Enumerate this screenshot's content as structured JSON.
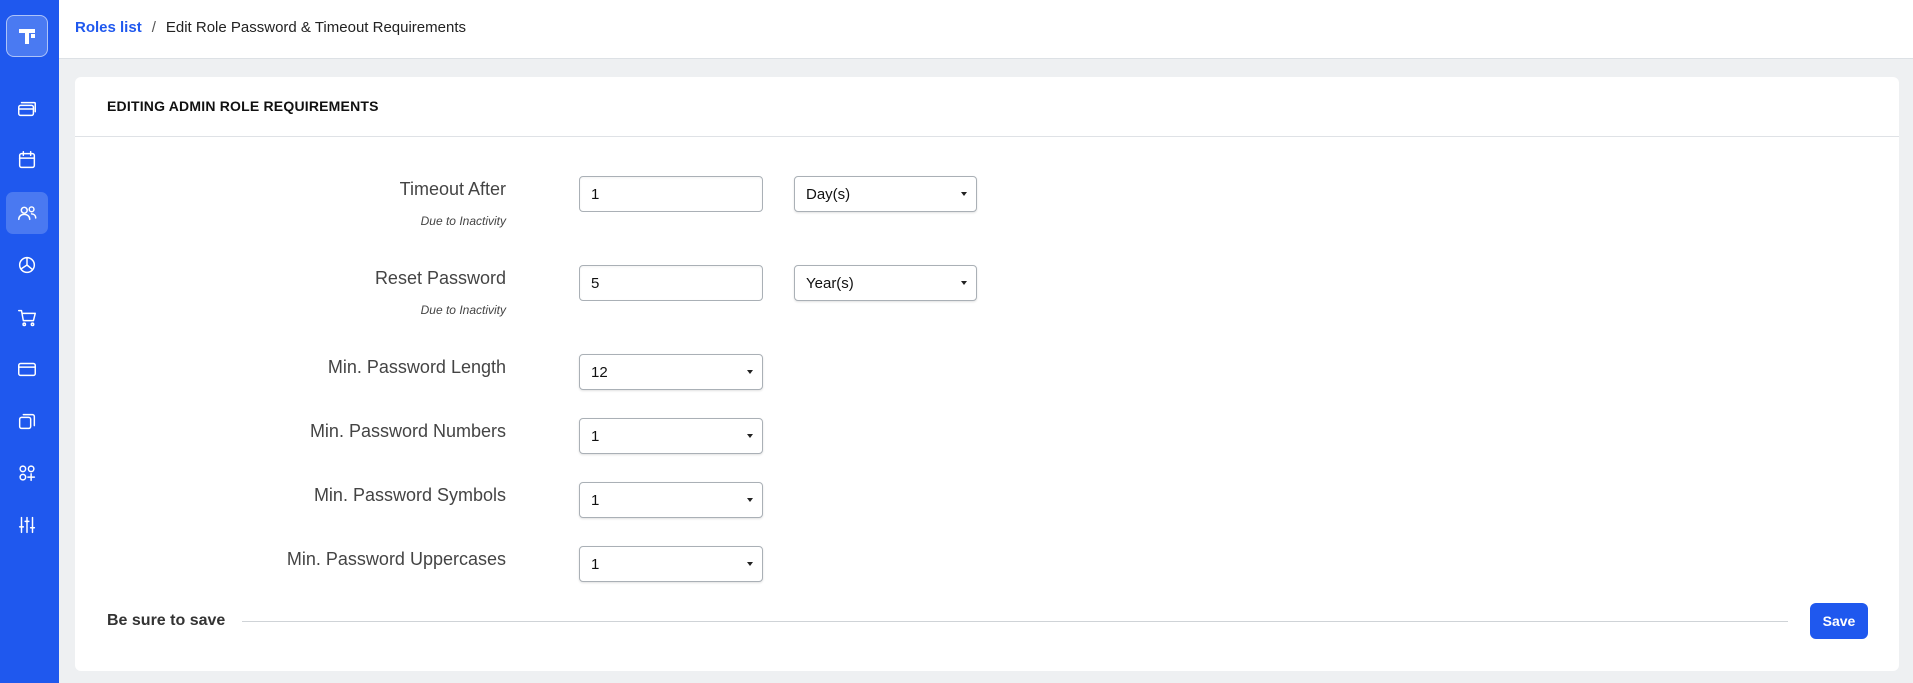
{
  "breadcrumb": {
    "link": "Roles list",
    "separator": "/",
    "current": "Edit Role Password & Timeout Requirements"
  },
  "sidebar": {
    "logo_icon": "app-logo-icon",
    "items": [
      {
        "icon": "cards-icon",
        "active": false
      },
      {
        "icon": "calendar-icon",
        "active": false
      },
      {
        "icon": "users-icon",
        "active": true
      },
      {
        "icon": "pie-chart-icon",
        "active": false
      },
      {
        "icon": "cart-icon",
        "active": false
      },
      {
        "icon": "credit-card-icon",
        "active": false
      },
      {
        "icon": "copy-icon",
        "active": false
      },
      {
        "icon": "apps-add-icon",
        "active": false
      },
      {
        "icon": "sliders-icon",
        "active": false
      }
    ]
  },
  "card": {
    "title": "EDITING ADMIN ROLE REQUIREMENTS"
  },
  "form": {
    "timeout": {
      "label": "Timeout After",
      "sub": "Due to Inactivity",
      "value": "1",
      "unit": "Day(s)"
    },
    "reset": {
      "label": "Reset Password",
      "sub": "Due to Inactivity",
      "value": "5",
      "unit": "Year(s)"
    },
    "min_length": {
      "label": "Min. Password Length",
      "value": "12"
    },
    "min_numbers": {
      "label": "Min. Password Numbers",
      "value": "1"
    },
    "min_symbols": {
      "label": "Min. Password Symbols",
      "value": "1"
    },
    "min_uppercases": {
      "label": "Min. Password Uppercases",
      "value": "1"
    }
  },
  "footer": {
    "reminder": "Be sure to save",
    "save_label": "Save"
  },
  "colors": {
    "brand": "#1f58ee",
    "sidebar_active": "#4a79f1"
  }
}
